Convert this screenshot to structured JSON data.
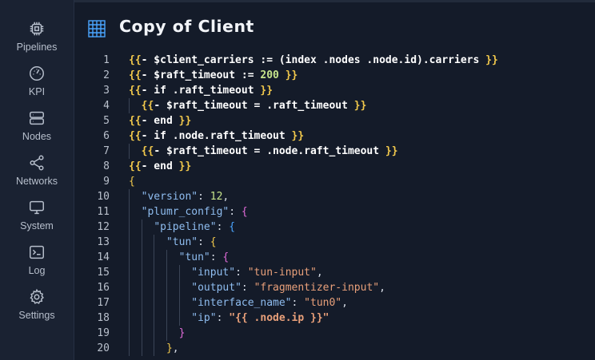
{
  "sidebar": {
    "items": [
      {
        "label": "Pipelines",
        "icon": "chip-icon"
      },
      {
        "label": "KPI",
        "icon": "gauge-icon"
      },
      {
        "label": "Nodes",
        "icon": "server-icon"
      },
      {
        "label": "Networks",
        "icon": "share-icon"
      },
      {
        "label": "System",
        "icon": "monitor-icon"
      },
      {
        "label": "Log",
        "icon": "terminal-icon"
      },
      {
        "label": "Settings",
        "icon": "gear-icon"
      }
    ]
  },
  "header": {
    "title": "Copy of Client",
    "icon": "grid-table-icon"
  },
  "editor": {
    "line_numbers": [
      "1",
      "2",
      "3",
      "4",
      "5",
      "6",
      "7",
      "8",
      "9",
      "10",
      "11",
      "12",
      "13",
      "14",
      "15",
      "16",
      "17",
      "18",
      "19",
      "20"
    ],
    "lines": [
      "{{- $client_carriers := (index .nodes .node.id).carriers }}",
      "{{- $raft_timeout := 200 }}",
      "{{- if .raft_timeout }}",
      "  {{- $raft_timeout = .raft_timeout }}",
      "{{- end }}",
      "{{- if .node.raft_timeout }}",
      "  {{- $raft_timeout = .node.raft_timeout }}",
      "{{- end }}",
      "{",
      "  \"version\": 12,",
      "  \"plumr_config\": {",
      "    \"pipeline\": {",
      "      \"tun\": {",
      "        \"tun\": {",
      "          \"input\": \"tun-input\",",
      "          \"output\": \"fragmentizer-input\",",
      "          \"interface_name\": \"tun0\",",
      "          \"ip\": \"{{ .node.ip }}\"",
      "        }",
      "      },"
    ]
  },
  "colors": {
    "background": "#141b29",
    "sidebar": "#1a2232",
    "template_brace": "#f2c94c",
    "string": "#e9a07a",
    "key": "#8fbdf0",
    "number": "#c6e48b",
    "bracket_level1": "#f2c94c",
    "bracket_level2": "#e06bd8",
    "bracket_level3": "#4aa5ff"
  }
}
